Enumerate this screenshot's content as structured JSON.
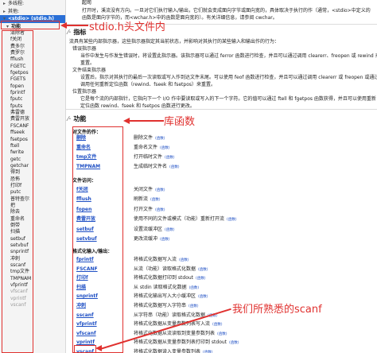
{
  "sidebar": {
    "tree": [
      {
        "label": "多线程:",
        "arrow": "▸"
      },
      {
        "label": "其他:",
        "arrow": "▸"
      },
      {
        "label": "<stdio> (stdio.h)",
        "arrow": "▾",
        "selected": true
      },
      {
        "label": "功能",
        "arrow": "▾",
        "group": true
      }
    ],
    "items": [
      "清除者",
      "f关闭",
      "费多尔",
      "费罗尔",
      "fflush",
      "FGETC",
      "fgetpos",
      "FGETS",
      "fopen",
      "fprintf",
      "fputc",
      "fputs",
      "弗雷德",
      "费雷开放",
      "FSCANF",
      "ffseek",
      "fsetpos",
      "ftell",
      "fwrite",
      "getc",
      "getchar",
      "得到",
      "恐怖",
      "打印f",
      "putc",
      "普特查尔",
      "把",
      "除去",
      "重命名",
      "倒带",
      "扫描",
      "setbuf",
      "setvbuf",
      "snprintf",
      "冲刺",
      "sscanf",
      "tmp文件",
      "TMPNAM",
      "vfprintf",
      "vfscanf",
      "vprintf",
      "vscanf"
    ],
    "faded_items": [
      "vfscanf",
      "vprintf",
      "vscanf"
    ]
  },
  "main": {
    "top_heading": "起司",
    "intro_lines": [
      "打开时，溪流没有方向。一旦对它们执行输入/输出，它们就会变成面向字节或面向宽的，具体取决于执行的作（通常，<stdio>中定义的",
      "函数是面向字节的，而<wchar.h>中的函数是面向宽的）。有关详细信息，请参阅 cwchar。"
    ],
    "pointer_section": {
      "title": "指标",
      "desc": "流具有某些内部指示器，这些指示器指定其当前状态，并影响对其执行的某些输入和输出作的行为：",
      "items": [
        {
          "head": "错误指示器",
          "text": "当作中发生与作发生错误时，将设置此指示器。该指示器可以通过 ferror 函数进行检查，并且可以通过调用 clearerr、freopen 或 rewind 来"
        },
        {
          "head": "",
          "text": "重置。"
        },
        {
          "head": "文件结束指示器",
          "text": "设置后，指示对其执行的最后一次读取或写入作到达文件末尾。可以使用 feof 函数进行检查，并且可以通过调用 clearerr 或 freopen 或通过"
        },
        {
          "head": "",
          "text": "调用任何重新定位函数（rewind、fseek 和 fsetpos）来重置。"
        },
        {
          "head": "位置指示器",
          "text": "它是每个流的内部指针，它指向下一个 I/O 作中要读取或写入的下一个字符。它的值可以通过 ftell 和 fgetpos 函数获得，并且可以使用重新"
        },
        {
          "head": "",
          "text": "定位函数 rewind、fseek 和 fsetpos 函数进行更改。"
        }
      ]
    },
    "functions_section": {
      "title": "功能",
      "subtitle": "对文件的作：",
      "ops": [
        {
          "name": "删除",
          "desc": "删除文件"
        },
        {
          "name": "重命名",
          "desc": "重命名文件"
        },
        {
          "name": "tmp文件",
          "desc": "打开临时文件"
        },
        {
          "name": "TMPNAM",
          "desc": "生成临时文件名"
        }
      ],
      "access_label": "文件访问：",
      "access": [
        {
          "name": "f关闭",
          "desc": "关闭文件"
        },
        {
          "name": "fflush",
          "desc": "刷新流"
        },
        {
          "name": "fopen",
          "desc": "打开文件"
        },
        {
          "name": "费雷开放",
          "desc": "使用不同的文件或模式（功能）重新打开流"
        },
        {
          "name": "setbuf",
          "desc": "设置流缓冲区"
        },
        {
          "name": "setvbuf",
          "desc": "更改流缓冲"
        }
      ],
      "format_label": "格式化输入/输出：",
      "format": [
        {
          "name": "fprintf",
          "desc": "将格式化数据写入流"
        },
        {
          "name": "FSCANF",
          "desc": "从流（功能）读取格式化数据"
        },
        {
          "name": "打印f",
          "desc": "将格式化数据打印到 stdout"
        },
        {
          "name": "扫描",
          "desc": "从 stdin 读取格式化数据"
        },
        {
          "name": "snprintf",
          "desc": "将格式化输出写入大小缓冲区"
        },
        {
          "name": "冲刺",
          "desc": "将格式化数据写入字符串"
        },
        {
          "name": "sscanf",
          "desc": "从字符串（功能）读取格式化数据"
        },
        {
          "name": "vfprintf",
          "desc": "将格式化数据从变量参数列表写入流"
        },
        {
          "name": "vfscanf",
          "desc": "将格式化数据从流读取到变量参数列表"
        },
        {
          "name": "vprintf",
          "desc": "将格式化数据从变量参数列表打印到 stdout"
        },
        {
          "name": "vscanf",
          "desc": "将格式化数据读入变量参数列表"
        }
      ],
      "tag": "(函数)"
    }
  },
  "annotations": {
    "header_label": "stdio.h头文件内",
    "library_label": "库函数",
    "scanf_label": "我们所熟悉的scanf"
  },
  "colors": {
    "accent": "#2a6fd6",
    "link": "#1e4fc4",
    "annotation": "#e0312f"
  }
}
